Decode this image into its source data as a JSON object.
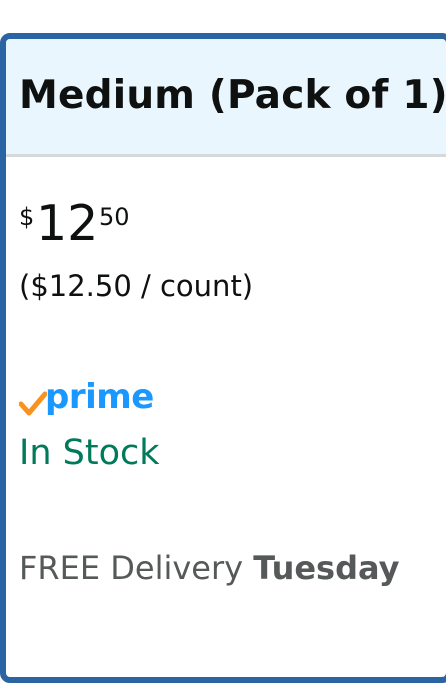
{
  "option": {
    "title": "Medium (Pack of 1)"
  },
  "price": {
    "symbol": "$",
    "whole": "12",
    "fraction": "50",
    "unit_price": "($12.50 / count)"
  },
  "prime": {
    "label": "prime",
    "icon": "prime-check-icon"
  },
  "availability": {
    "status": "In Stock"
  },
  "delivery": {
    "prefix": "FREE Delivery ",
    "day": "Tuesday"
  },
  "colors": {
    "selected_border": "#2a64a3",
    "header_bg": "#eaf6fd",
    "in_stock": "#007a5a",
    "prime_blue": "#1a98ff",
    "prime_check": "#f7931e"
  }
}
